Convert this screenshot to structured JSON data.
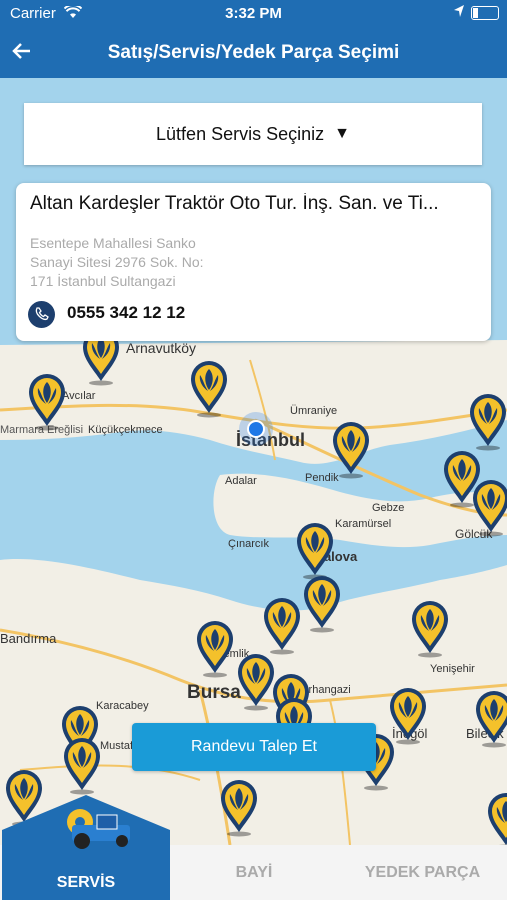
{
  "status_bar": {
    "carrier": "Carrier",
    "time": "3:32 PM"
  },
  "navbar": {
    "title": "Satış/Servis/Yedek Parça Seçimi",
    "back_icon": "arrow-left-icon"
  },
  "selector": {
    "label": "Lütfen Servis Seçiniz",
    "icon": "triangle-down-icon"
  },
  "service_card": {
    "name": "Altan Kardeşler Traktör Oto Tur. İnş. San. ve Ti...",
    "address_line1": "Esentepe Mahallesi Sanko",
    "address_line2": "Sanayi Sitesi 2976 Sok. No:",
    "address_line3": "171 İstanbul Sultangazi",
    "phone": "0555 342 12 12"
  },
  "map": {
    "labels": [
      "Arnavutköy",
      "Ümraniye",
      "İstanbul",
      "Küçükçekmece",
      "Marmara Ereğlisi",
      "Pendik",
      "Adalar",
      "Gebze",
      "Karamürsel",
      "Gölcük",
      "Çınarcık",
      "Yalova",
      "Bandırma",
      "Bursa",
      "İnegöl",
      "Bilecik",
      "Karacabey",
      "Mustafakemalpaşa",
      "Yenişehir",
      "Gemlik",
      "Orhangazi",
      "Avcılar"
    ],
    "pin_icon": "new-holland-pin-icon",
    "accent": "#f4c12b",
    "pin_dark": "#1d3f6e"
  },
  "randevu_button": "Randevu Talep Et",
  "tabs": [
    {
      "label": "SERVİS",
      "active": true
    },
    {
      "label": "BAYİ",
      "active": false
    },
    {
      "label": "YEDEK PARÇA",
      "active": false
    }
  ]
}
